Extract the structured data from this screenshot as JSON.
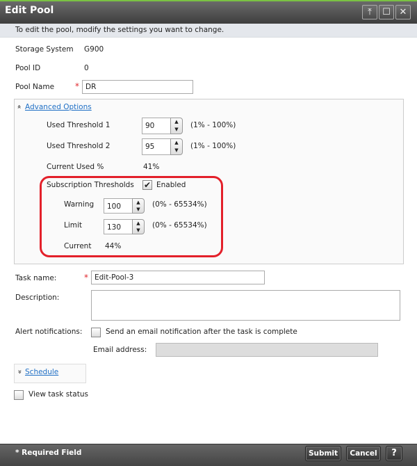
{
  "window": {
    "title": "Edit Pool",
    "pin": "⤒",
    "maximize": "☐",
    "close": "✕"
  },
  "info": "To edit the pool, modify the settings you want to change.",
  "storage_system": {
    "label": "Storage System",
    "value": "G900"
  },
  "pool_id": {
    "label": "Pool ID",
    "value": "0"
  },
  "pool_name": {
    "label": "Pool Name",
    "required": "*",
    "value": "DR"
  },
  "advanced": {
    "toggle_icon": "»",
    "label": "Advanced Options",
    "used_threshold_1": {
      "label": "Used Threshold 1",
      "value": "90",
      "range": "(1% - 100%)"
    },
    "used_threshold_2": {
      "label": "Used Threshold 2",
      "value": "95",
      "range": "(1% - 100%)"
    },
    "current_used": {
      "label": "Current Used %",
      "value": "41%"
    },
    "subscription": {
      "label": "Subscription Thresholds",
      "checkbox": "✔",
      "enabled_label": "Enabled",
      "warning": {
        "label": "Warning",
        "value": "100",
        "range": "(0% - 65534%)"
      },
      "limit": {
        "label": "Limit",
        "value": "130",
        "range": "(0% - 65534%)"
      },
      "current": {
        "label": "Current",
        "value": "44%"
      }
    }
  },
  "task": {
    "name_label": "Task name:",
    "required": "*",
    "name_value": "Edit-Pool-3",
    "description_label": "Description:",
    "description_value": "",
    "alert_label": "Alert notifications:",
    "alert_text": "Send an email notification after the task is complete",
    "email_label": "Email address:",
    "email_value": ""
  },
  "schedule": {
    "toggle_icon": "»",
    "label": "Schedule"
  },
  "view_task_status": "View task status",
  "footer": {
    "required_note": "* Required Field",
    "submit": "Submit",
    "cancel": "Cancel",
    "help": "?"
  },
  "colors": {
    "accent": "#7ac143",
    "highlight": "#e3202a",
    "link": "#1f6fc5"
  }
}
